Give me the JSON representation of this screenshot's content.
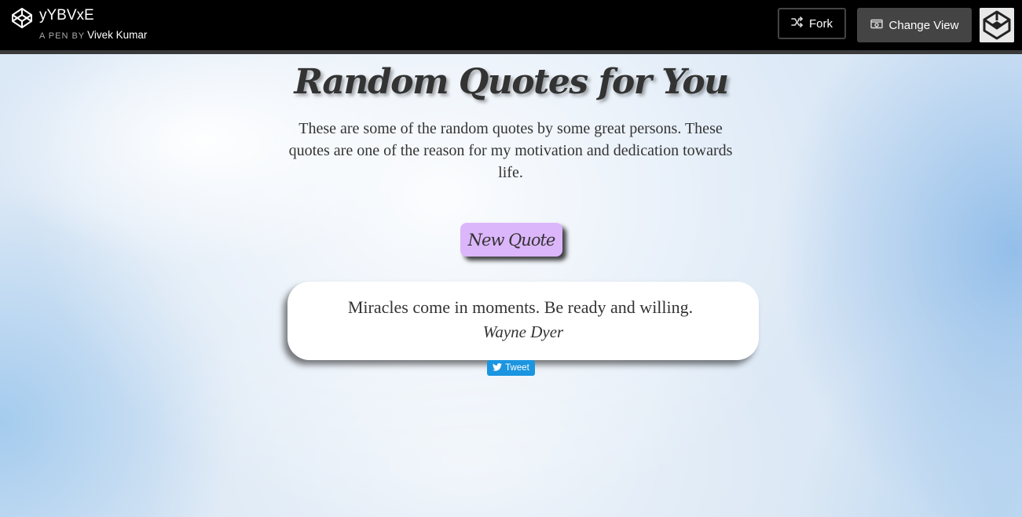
{
  "header": {
    "pen_title": "yYBVxE",
    "pen_by_label": "A PEN BY",
    "author": "Vivek Kumar",
    "fork_label": "Fork",
    "change_view_label": "Change View",
    "icons": [
      "codepen-logo-icon",
      "fork-icon",
      "change-view-icon",
      "codepen-avatar-icon"
    ]
  },
  "page": {
    "title": "Random Quotes for You",
    "intro": "These are some of the random quotes by some great persons. These quotes are one of the reason for my motivation and dedication towards life.",
    "new_quote_label": "New Quote",
    "quote": {
      "text": "Miracles come in moments. Be ready and willing.",
      "author": "Wayne Dyer"
    },
    "tweet_label": "Tweet"
  },
  "colors": {
    "topbar": "#000000",
    "button_dark": "#444444",
    "new_quote_bg": "#dcb6fb",
    "tweet_bg": "#1b95e0",
    "text": "#333333"
  }
}
